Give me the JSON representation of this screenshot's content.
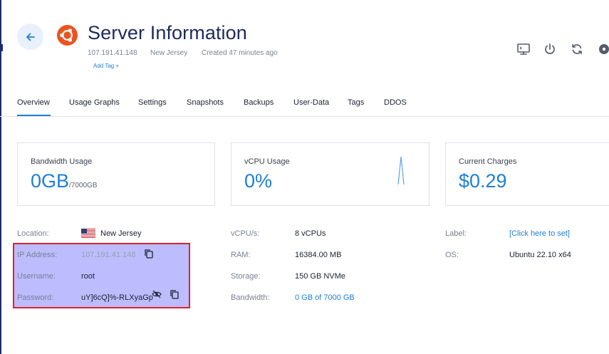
{
  "header": {
    "title": "Server Information",
    "ip": "107.191.41.148",
    "location": "New Jersey",
    "created": "Created 47 minutes ago",
    "add_tag": "Add Tag +",
    "os_logo_icon": "ubuntu-logo-icon",
    "brand_color": "#e95420"
  },
  "toolbar_icons": [
    "console-icon",
    "power-icon",
    "restart-icon",
    "os-icon"
  ],
  "tabs": [
    "Overview",
    "Usage Graphs",
    "Settings",
    "Snapshots",
    "Backups",
    "User-Data",
    "Tags",
    "DDOS"
  ],
  "active_tab": "Overview",
  "cards": {
    "bandwidth": {
      "label": "Bandwidth Usage",
      "value": "0GB",
      "sub": "/7000GB"
    },
    "vcpu": {
      "label": "vCPU Usage",
      "value": "0%"
    },
    "charges": {
      "label": "Current Charges",
      "value": "$0.29"
    }
  },
  "details": {
    "location_label": "Location:",
    "location_value": "New Jersey",
    "ip_label": "IP Address:",
    "ip_value": "107.191.41.148",
    "username_label": "Username:",
    "username_value": "root",
    "password_label": "Password:",
    "password_value": "uY]6cQ]%-RLXyaGp",
    "vcpu_label": "vCPU/s:",
    "vcpu_value": "8 vCPUs",
    "ram_label": "RAM:",
    "ram_value": "16384.00 MB",
    "storage_label": "Storage:",
    "storage_value": "150 GB NVMe",
    "bandwidth_label": "Bandwidth:",
    "bandwidth_value": "0 GB of 7000 GB",
    "label_label": "Label:",
    "label_value": "[Click here to set]",
    "os_label": "OS:",
    "os_value": "Ubuntu 22.10 x64"
  },
  "colors": {
    "accent": "#1e7fd6",
    "highlight_fill": "#5050ff",
    "highlight_border": "#e0202a"
  }
}
